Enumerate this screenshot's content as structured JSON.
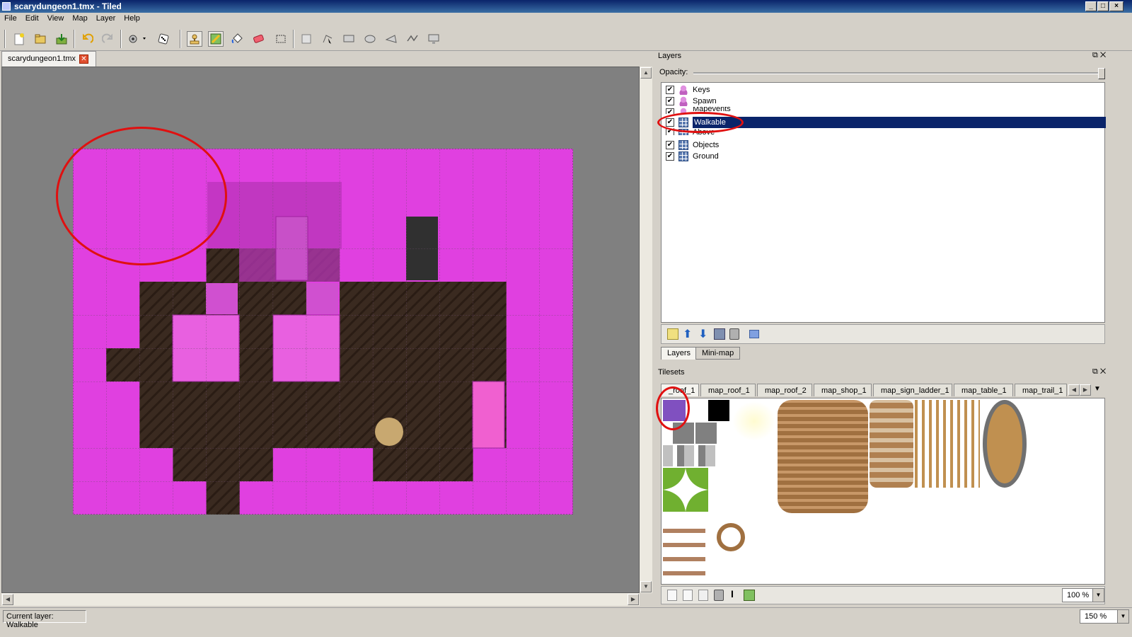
{
  "window": {
    "title": "scarydungeon1.tmx - Tiled",
    "min": "_",
    "max": "□",
    "close": "×"
  },
  "menu": [
    "File",
    "Edit",
    "View",
    "Map",
    "Layer",
    "Help"
  ],
  "document_tab": {
    "label": "scarydungeon1.tmx"
  },
  "layers_panel": {
    "title": "Layers",
    "opacity_label": "Opacity:",
    "opacity_value": 1.0,
    "layers": [
      {
        "name": "Keys",
        "type": "object",
        "visible": true,
        "selected": false
      },
      {
        "name": "Spawn",
        "type": "object",
        "visible": true,
        "selected": false
      },
      {
        "name": "Mapevents",
        "type": "object",
        "visible": true,
        "selected": false
      },
      {
        "name": "Walkable",
        "type": "tile",
        "visible": true,
        "selected": true
      },
      {
        "name": "Above",
        "type": "tile",
        "visible": true,
        "selected": false
      },
      {
        "name": "Objects",
        "type": "tile",
        "visible": true,
        "selected": false
      },
      {
        "name": "Ground",
        "type": "tile",
        "visible": true,
        "selected": false
      }
    ],
    "tabs": [
      "Layers",
      "Mini-map"
    ]
  },
  "tilesets_panel": {
    "title": "Tilesets",
    "tabs": [
      "_roof_1",
      "map_roof_1",
      "map_roof_2",
      "map_shop_1",
      "map_sign_ladder_1",
      "map_table_1",
      "map_trail_1"
    ],
    "zoom": "100 %"
  },
  "status": {
    "current_layer": "Current layer: Walkable",
    "zoom": "150 %"
  },
  "colors": {
    "walkable": "#e040e0",
    "ground_dark": "#3a2a20",
    "selection": "#0a246a",
    "annotation": "#e01010"
  }
}
